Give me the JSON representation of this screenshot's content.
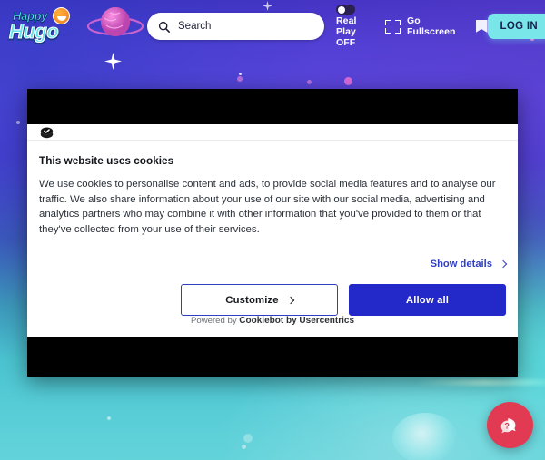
{
  "topbar": {
    "logo": {
      "word1": "Happy",
      "word2": "Hugo",
      "icon": "smiley-face-icon"
    },
    "search": {
      "placeholder": "Search",
      "value": "",
      "icon": "search-icon"
    },
    "real_play": {
      "line1": "Real",
      "line2": "Play",
      "line3": "OFF",
      "toggle_state": "off",
      "icon": "toggle-switch-icon"
    },
    "fullscreen": {
      "line1": "Go",
      "line2": "Fullscreen",
      "icon": "fullscreen-expand-icon"
    },
    "flag": {
      "icon": "flag-bookmark-icon"
    },
    "login_label": "LOG IN"
  },
  "cookie_dialog": {
    "logo_icon": "cookiebot-cookie-icon",
    "title": "This website uses cookies",
    "description": "We use cookies to personalise content and ads, to provide social media features and to analyse our traffic. We also share information about your use of our site with our social media, advertising and analytics partners who may combine it with other information that you've provided to them or that they've collected from your use of their services.",
    "show_details_label": "Show details",
    "show_details_icon": "chevron-right-icon",
    "customize_label": "Customize",
    "customize_icon": "chevron-right-icon",
    "allow_all_label": "Allow all",
    "footer_prefix": "Powered by ",
    "footer_brand": "Cookiebot by Usercentrics"
  },
  "chat_widget": {
    "icon": "chat-question-bubble-icon",
    "label": ""
  },
  "colors": {
    "accent_blue": "#2328c8",
    "link_blue": "#2f3ec4",
    "login_cyan": "#79e7ea",
    "chat_red": "#e13a52",
    "bg_purple": "#5340d6",
    "bg_teal": "#63d3da",
    "dialog_white": "#ffffff",
    "frame_black": "#000000"
  }
}
